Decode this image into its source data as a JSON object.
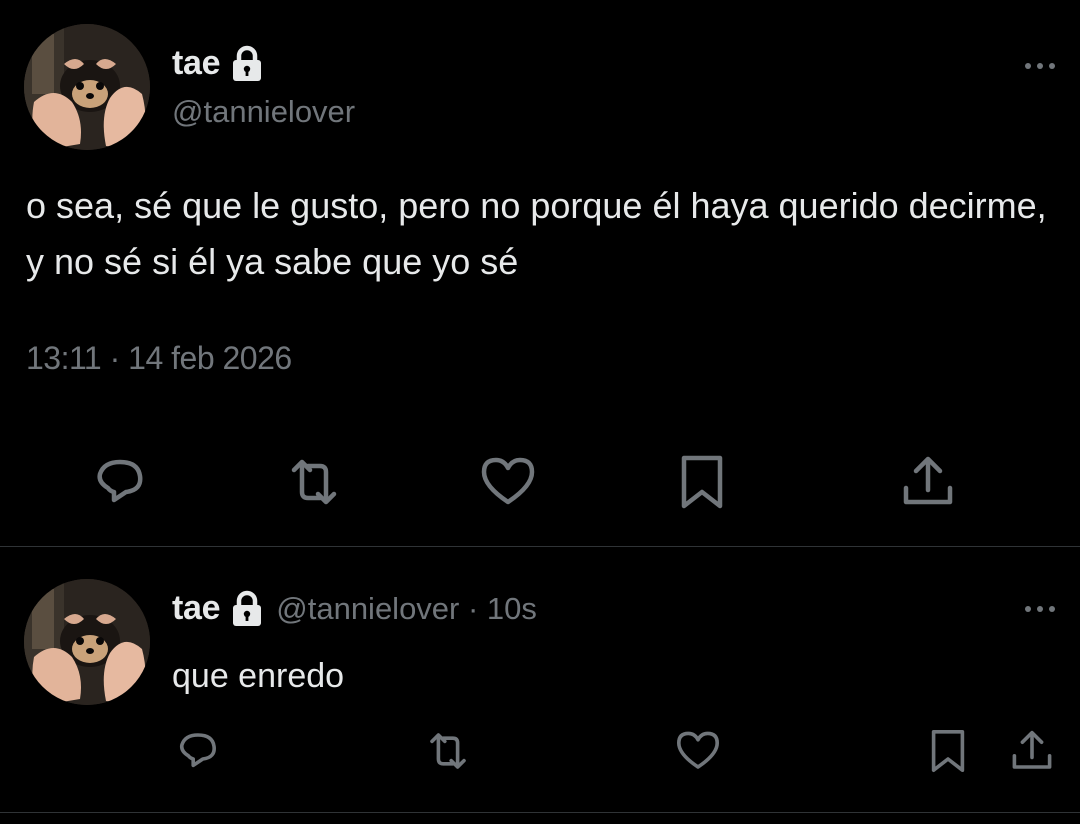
{
  "tweet": {
    "author": {
      "display_name": "tae",
      "handle": "@tannielover",
      "protected": true,
      "avatar": "avatar-icon"
    },
    "text": "o sea, sé que le gusto, pero no porque él haya querido decirme, y no sé si él ya sabe que yo sé",
    "timestamp": "13:11 · 14 feb 2026",
    "actions": [
      "reply-icon",
      "retweet-icon",
      "like-icon",
      "bookmark-icon",
      "share-icon"
    ]
  },
  "reply": {
    "author": {
      "display_name": "tae",
      "handle_time": "@tannielover · 10s",
      "protected": true,
      "avatar": "avatar-icon"
    },
    "text": "que enredo",
    "actions": [
      "reply-icon",
      "retweet-icon",
      "like-icon",
      "bookmark-icon",
      "share-icon"
    ]
  },
  "colors": {
    "background": "#000000",
    "text_primary": "#e7e9ea",
    "text_secondary": "#71767b",
    "divider": "#2f3336"
  }
}
